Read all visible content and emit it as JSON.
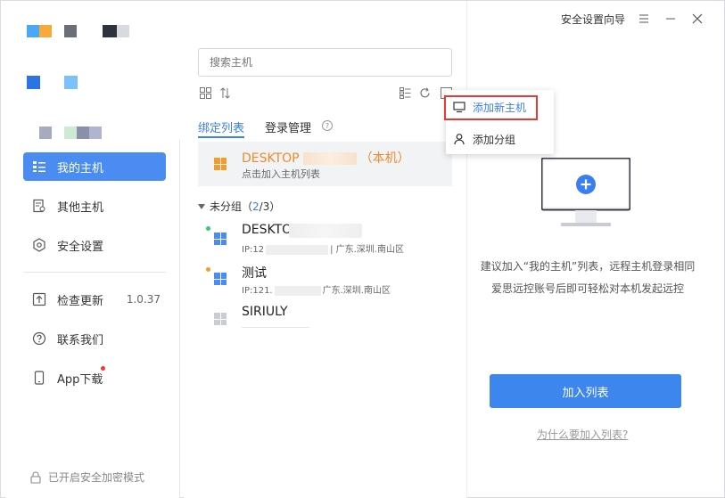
{
  "window": {
    "security_wizard": "安全设置向导"
  },
  "sidebar": {
    "items": [
      {
        "label": "我的主机",
        "icon": "host-list-icon"
      },
      {
        "label": "其他主机",
        "icon": "other-host-icon"
      },
      {
        "label": "安全设置",
        "icon": "hexagon-settings-icon"
      },
      {
        "label": "检查更新",
        "icon": "upload-icon",
        "version": "1.0.37"
      },
      {
        "label": "联系我们",
        "icon": "question-icon"
      },
      {
        "label": "App下载",
        "icon": "phone-icon"
      }
    ],
    "footer": "已开启安全加密模式"
  },
  "mid": {
    "search_placeholder": "搜索主机",
    "tabs": [
      "绑定列表",
      "登录管理"
    ],
    "local_host": {
      "name": "DESKTOP",
      "tag": "（本机）",
      "sub": "点击加入主机列表"
    },
    "group": {
      "name": "未分组（",
      "count_cur": "2",
      "count_rest": "/3）"
    },
    "hosts": [
      {
        "name": "DESKTO",
        "ip": "IP:12",
        "loc": "| 广东.深圳.南山区"
      },
      {
        "name": "测试",
        "ip": "IP:121.",
        "loc": "广东.深圳.南山区"
      },
      {
        "name": "SIRIULY",
        "ip": "",
        "loc": ""
      }
    ]
  },
  "dropdown": {
    "add_host": "添加新主机",
    "add_group": "添加分组"
  },
  "right": {
    "desc_line1": "建议加入“我的主机”列表，远程主机登录相同",
    "desc_line2": "爱思远控账号后即可轻松对本机发起远控",
    "join_button": "加入列表",
    "why_link": "为什么要加入列表?"
  }
}
